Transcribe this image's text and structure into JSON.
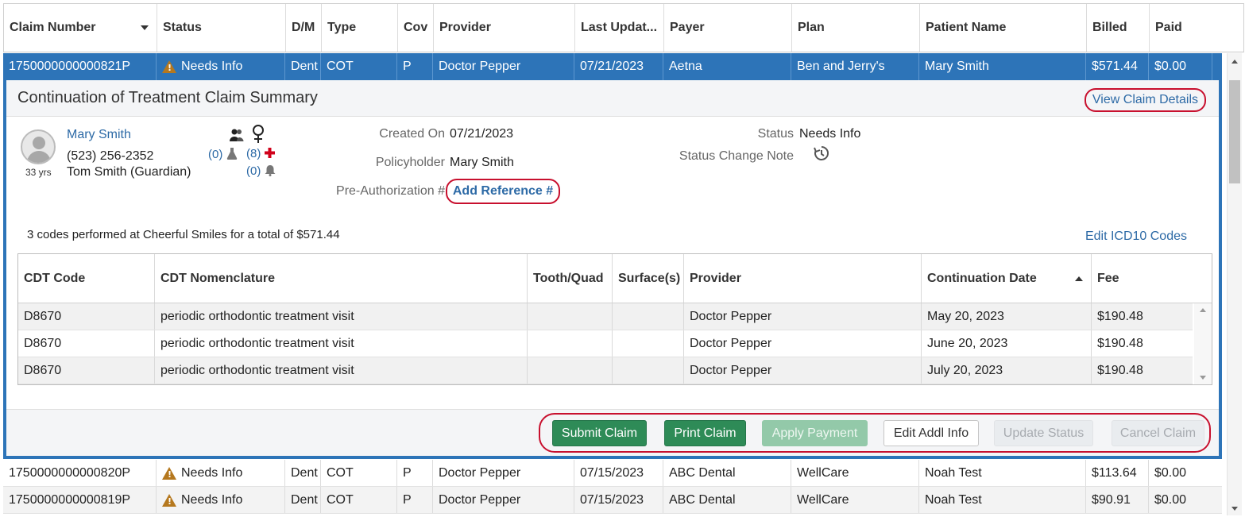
{
  "grid": {
    "columns": [
      "Claim Number",
      "Status",
      "D/M",
      "Type",
      "Cov",
      "Provider",
      "Last Updat...",
      "Payer",
      "Plan",
      "Patient Name",
      "Billed",
      "Paid"
    ],
    "rows": [
      {
        "claim": "1750000000000821P",
        "status": "Needs Info",
        "dm": "Dent",
        "type": "COT",
        "cov": "P",
        "provider": "Doctor Pepper",
        "updated": "07/21/2023",
        "payer": "Aetna",
        "plan": "Ben and Jerry's",
        "patient": "Mary Smith",
        "billed": "$571.44",
        "paid": "$0.00"
      },
      {
        "claim": "1750000000000820P",
        "status": "Needs Info",
        "dm": "Dent",
        "type": "COT",
        "cov": "P",
        "provider": "Doctor Pepper",
        "updated": "07/15/2023",
        "payer": "ABC Dental",
        "plan": "WellCare",
        "patient": "Noah Test",
        "billed": "$113.64",
        "paid": "$0.00"
      },
      {
        "claim": "1750000000000819P",
        "status": "Needs Info",
        "dm": "Dent",
        "type": "COT",
        "cov": "P",
        "provider": "Doctor Pepper",
        "updated": "07/15/2023",
        "payer": "ABC Dental",
        "plan": "WellCare",
        "patient": "Noah Test",
        "billed": "$90.91",
        "paid": "$0.00"
      }
    ]
  },
  "detail": {
    "title": "Continuation of Treatment Claim Summary",
    "view_link": "View Claim Details",
    "patient": {
      "name": "Mary Smith",
      "phone": "(523) 256-2352",
      "guardian": "Tom Smith (Guardian)",
      "age": "33 yrs",
      "lab_count": "(0)",
      "med_count": "(8)",
      "alert_count": "(0)"
    },
    "created_on_label": "Created On",
    "created_on": "07/21/2023",
    "policyholder_label": "Policyholder",
    "policyholder": "Mary Smith",
    "preauth_label": "Pre-Authorization #",
    "preauth_link": "Add Reference #",
    "status_label": "Status",
    "status": "Needs Info",
    "status_note_label": "Status Change Note",
    "codes_summary": "3 codes performed at Cheerful Smiles for a total of $571.44",
    "edit_icd": "Edit ICD10 Codes",
    "codes_columns": [
      "CDT Code",
      "CDT Nomenclature",
      "Tooth/Quad",
      "Surface(s)",
      "Provider",
      "Continuation Date",
      "Fee"
    ],
    "codes": [
      {
        "code": "D8670",
        "nomenclature": "periodic orthodontic treatment visit",
        "tooth": "",
        "surface": "",
        "provider": "Doctor Pepper",
        "date": "May 20, 2023",
        "fee": "$190.48"
      },
      {
        "code": "D8670",
        "nomenclature": "periodic orthodontic treatment visit",
        "tooth": "",
        "surface": "",
        "provider": "Doctor Pepper",
        "date": "June 20, 2023",
        "fee": "$190.48"
      },
      {
        "code": "D8670",
        "nomenclature": "periodic orthodontic treatment visit",
        "tooth": "",
        "surface": "",
        "provider": "Doctor Pepper",
        "date": "July 20, 2023",
        "fee": "$190.48"
      }
    ],
    "actions": {
      "submit": "Submit Claim",
      "print": "Print Claim",
      "apply_payment": "Apply Payment",
      "edit_addl": "Edit Addl Info",
      "update_status": "Update Status",
      "cancel": "Cancel Claim"
    }
  },
  "colors": {
    "selected_row": "#2d74b8",
    "link": "#2d6aa6",
    "highlight_outline": "#c8102e",
    "primary_button": "#2e8b57",
    "warning_icon": "#b5781e"
  }
}
